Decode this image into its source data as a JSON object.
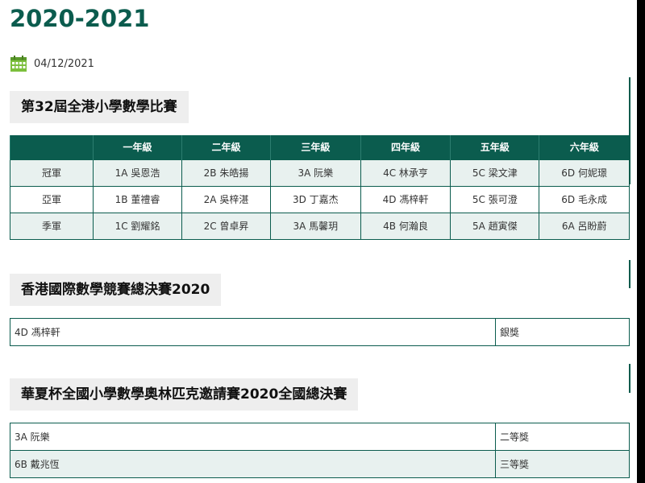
{
  "page": {
    "year_title": "2020-2021",
    "date": "04/12/2021"
  },
  "section1": {
    "heading": "第32屆全港小學數學比賽",
    "headers": [
      "",
      "一年級",
      "二年級",
      "三年級",
      "四年級",
      "五年級",
      "六年級"
    ],
    "rows": [
      [
        "冠軍",
        "1A 吳恩浩",
        "2B 朱皓揚",
        "3A 阮樂",
        "4C 林承亨",
        "5C 梁文津",
        "6D 何妮璟"
      ],
      [
        "亞軍",
        "1B 董禮睿",
        "2A 吳梓湛",
        "3D 丁嘉杰",
        "4D 馮梓軒",
        "5C 張可澄",
        "6D 毛永成"
      ],
      [
        "季軍",
        "1C 劉耀銘",
        "2C 曾卓昇",
        "3A 馬馨玥",
        "4B 何瀚良",
        "5A 趙寅傑",
        "6A 呂盼蔚"
      ]
    ]
  },
  "section2": {
    "heading": "香港國際數學競賽總決賽2020",
    "rows": [
      [
        "4D 馮梓軒",
        "銀獎"
      ]
    ]
  },
  "section3": {
    "heading": "華夏杯全國小學數學奧林匹克邀請賽2020全國總決賽",
    "rows": [
      [
        "3A 阮樂",
        "二等獎"
      ],
      [
        "6B 戴兆恆",
        "三等獎"
      ]
    ]
  },
  "colors": {
    "accent": "#0b5c4e",
    "row_shade": "#e8f1ef",
    "heading_bg": "#eeeeee"
  },
  "icons": {
    "date": "calendar-icon"
  }
}
